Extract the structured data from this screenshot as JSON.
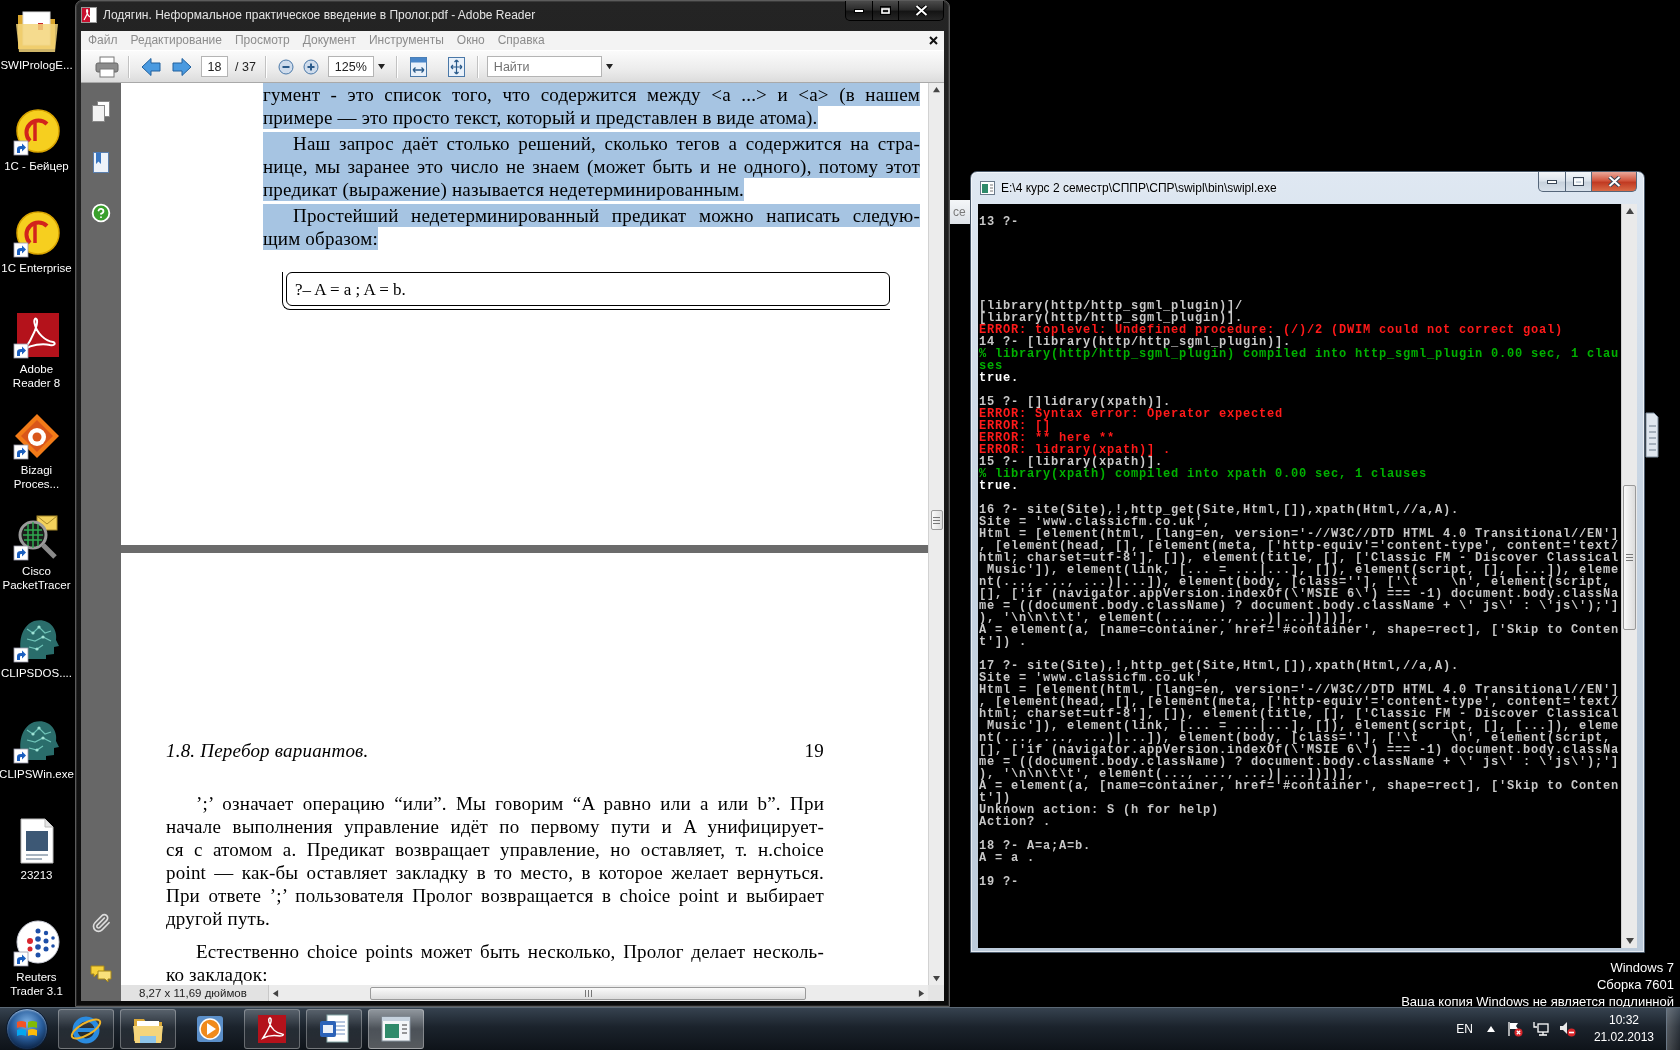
{
  "desktop": {
    "icons": [
      {
        "kind": "folder",
        "shortcut": false,
        "label": [
          "SWIPrologE..."
        ]
      },
      {
        "kind": "disc",
        "shortcut": true,
        "label": [
          "1C - Бейцер"
        ]
      },
      {
        "kind": "disc",
        "shortcut": true,
        "label": [
          "1C Enterprise"
        ]
      },
      {
        "kind": "pdf",
        "shortcut": true,
        "label": [
          "Adobe",
          "Reader 8"
        ]
      },
      {
        "kind": "diamond",
        "shortcut": true,
        "label": [
          "Bizagi",
          "Proces..."
        ]
      },
      {
        "kind": "magnifier",
        "shortcut": true,
        "label": [
          "Cisco",
          "PacketTracer"
        ]
      },
      {
        "kind": "head",
        "shortcut": true,
        "label": [
          "CLIPSDOS...."
        ]
      },
      {
        "kind": "head",
        "shortcut": true,
        "label": [
          "CLIPSWin.exe"
        ]
      },
      {
        "kind": "document",
        "shortcut": false,
        "label": [
          "23213"
        ]
      },
      {
        "kind": "dots",
        "shortcut": true,
        "label": [
          "Reuters",
          "Trader 3.1"
        ]
      }
    ],
    "notice": [
      "Windows 7",
      "Сборка 7601",
      "Ваша копия Windows не является подлинной"
    ]
  },
  "background_window": {
    "title": "ce"
  },
  "reader": {
    "title": "Лодягин. Неформальное практическое введение в Пролог.pdf - Adobe Reader",
    "active": false,
    "menu": [
      "Файл",
      "Редактирование",
      "Просмотр",
      "Документ",
      "Инструменты",
      "Окно",
      "Справка"
    ],
    "toolbar": {
      "page": "18",
      "page_count": "/ 37",
      "zoom": "125%",
      "find_placeholder": "Найти"
    },
    "pages": [
      {
        "blocks": [
          {
            "kind": "paragraph",
            "indented": false,
            "highlighted": true,
            "lines": [
              "гумент - это список того, что содержится между <a ...> и <a> (в нашем",
              "примере — это просто текст, который и представлен в виде атома)."
            ]
          },
          {
            "kind": "paragraph",
            "indented": true,
            "highlighted": true,
            "lines": [
              "Наш запрос даёт столько решений, сколько тегов a содержится на стра-",
              "нице, мы заранее это число не знаем (может быть и не одного), потому этот",
              "предикат (выражение) называется недетерминированным."
            ]
          },
          {
            "kind": "paragraph",
            "indented": true,
            "highlighted": true,
            "lines": [
              "Простейший недетерминированный предикат можно написать следую-",
              "щим образом:"
            ]
          },
          {
            "kind": "code",
            "text": "?– A = a ; A = b."
          }
        ]
      },
      {
        "running_header": {
          "title": "1.8. Перебор вариантов.",
          "number": "19"
        },
        "blocks": [
          {
            "kind": "paragraph",
            "indented": true,
            "highlighted": false,
            "lines": [
              "’;’ означает операцию “или”. Мы говорим “A равно или a или b”. При",
              "начале выполнения управление идёт по первому пути и A унифицирует-",
              "ся с атомом a. Предикат возвращает управление, но оставляет, т. н.choice",
              "point — как-бы оставляет закладку в то место, в которое желает вернуться.",
              "При ответе ’;’ пользователя Пролог возвращается в choice point и выбирает",
              "другой путь."
            ]
          },
          {
            "kind": "paragraph",
            "indented": true,
            "highlighted": false,
            "lines": [
              "Естественно choice points может быть несколько, Пролог делает несколь-",
              "ко закладок:"
            ]
          }
        ]
      }
    ],
    "status": "8,27 x 11,69 дюймов"
  },
  "console": {
    "title": "E:\\4 курс 2 семестр\\СППР\\СПР\\swipl\\bin\\swipl.exe",
    "active": true,
    "lines": [
      {
        "kind": "text",
        "text": "13 ?-"
      },
      {
        "kind": "blank"
      },
      {
        "kind": "blank"
      },
      {
        "kind": "blank"
      },
      {
        "kind": "blank"
      },
      {
        "kind": "blank"
      },
      {
        "kind": "blank"
      },
      {
        "kind": "text",
        "text": "[library(http/http_sgml_plugin)]/"
      },
      {
        "kind": "text",
        "text": "[library(http/http_sgml_plugin)]."
      },
      {
        "kind": "error",
        "text": "ERROR: toplevel: Undefined procedure: (/)/2 (DWIM could not correct goal)"
      },
      {
        "kind": "text",
        "text": "14 ?- [library(http/http_sgml_plugin)]."
      },
      {
        "kind": "info",
        "text": "% library(http/http_sgml_plugin) compiled into http_sgml_plugin 0.00 sec, 1 clau"
      },
      {
        "kind": "info",
        "text": "ses"
      },
      {
        "kind": "result",
        "text": "true."
      },
      {
        "kind": "blank"
      },
      {
        "kind": "text",
        "text": "15 ?- []lidrary(xpath)]."
      },
      {
        "kind": "error",
        "text": "ERROR: Syntax error: Operator expected"
      },
      {
        "kind": "error",
        "text": "ERROR: []"
      },
      {
        "kind": "error",
        "text": "ERROR: ** here **"
      },
      {
        "kind": "error",
        "text": "ERROR: lidrary(xpath)] ."
      },
      {
        "kind": "text",
        "text": "15 ?- [library(xpath)]."
      },
      {
        "kind": "info",
        "text": "% library(xpath) compiled into xpath 0.00 sec, 1 clauses"
      },
      {
        "kind": "result",
        "text": "true."
      },
      {
        "kind": "blank"
      },
      {
        "kind": "text",
        "text": "16 ?- site(Site),!,http_get(Site,Html,[]),xpath(Html,//a,A)."
      },
      {
        "kind": "text",
        "text": "Site = 'www.classicfm.co.uk',"
      },
      {
        "kind": "text",
        "text": "Html = [element(html, [lang=en, version='-//W3C//DTD HTML 4.0 Transitional//EN']"
      },
      {
        "kind": "text",
        "text": ", [element(head, [], [element(meta, ['http-equiv'='content-type', content='text/"
      },
      {
        "kind": "text",
        "text": "html; charset=utf-8'], []), element(title, [], ['Classic FM - Discover Classical"
      },
      {
        "kind": "text",
        "text": " Music']), element(link, [... = ...|...], []), element(script, [], [...]), eleme"
      },
      {
        "kind": "text",
        "text": "nt(..., ..., ...)|...]), element(body, [class=''], ['\\t    \\n', element(script,"
      },
      {
        "kind": "text",
        "text": "[], ['if (navigator.appVersion.indexOf(\\'MSIE 6\\') === -1) document.body.classNa"
      },
      {
        "kind": "text",
        "text": "me = ((document.body.className) ? document.body.className + \\' js\\' : \\'js\\');']"
      },
      {
        "kind": "text",
        "text": "), '\\n\\n\\t\\t', element(..., ..., ...)|...])])],"
      },
      {
        "kind": "text",
        "text": "A = element(a, [name=container, href='#container', shape=rect], ['Skip to Conten"
      },
      {
        "kind": "text",
        "text": "t']) ."
      },
      {
        "kind": "blank"
      },
      {
        "kind": "text",
        "text": "17 ?- site(Site),!,http_get(Site,Html,[]),xpath(Html,//a,A)."
      },
      {
        "kind": "text",
        "text": "Site = 'www.classicfm.co.uk',"
      },
      {
        "kind": "text",
        "text": "Html = [element(html, [lang=en, version='-//W3C//DTD HTML 4.0 Transitional//EN']"
      },
      {
        "kind": "text",
        "text": ", [element(head, [], [element(meta, ['http-equiv'='content-type', content='text/"
      },
      {
        "kind": "text",
        "text": "html; charset=utf-8'], []), element(title, [], ['Classic FM - Discover Classical"
      },
      {
        "kind": "text",
        "text": " Music']), element(link, [... = ...|...], []), element(script, [], [...]), eleme"
      },
      {
        "kind": "text",
        "text": "nt(..., ..., ...)|...]), element(body, [class=''], ['\\t    \\n', element(script,"
      },
      {
        "kind": "text",
        "text": "[], ['if (navigator.appVersion.indexOf(\\'MSIE 6\\') === -1) document.body.classNa"
      },
      {
        "kind": "text",
        "text": "me = ((document.body.className) ? document.body.className + \\' js\\' : \\'js\\');']"
      },
      {
        "kind": "text",
        "text": "), '\\n\\n\\t\\t', element(..., ..., ...)|...])])],"
      },
      {
        "kind": "text",
        "text": "A = element(a, [name=container, href='#container', shape=rect], ['Skip to Conten"
      },
      {
        "kind": "text",
        "text": "t'])"
      },
      {
        "kind": "text",
        "text": "Unknown action: S (h for help)"
      },
      {
        "kind": "text",
        "text": "Action? ."
      },
      {
        "kind": "blank"
      },
      {
        "kind": "text",
        "text": "18 ?- A=a;A=b."
      },
      {
        "kind": "text",
        "text": "A = a ."
      },
      {
        "kind": "blank"
      },
      {
        "kind": "text",
        "text": "19 ?-"
      }
    ]
  },
  "taskbar": {
    "apps": [
      {
        "kind": "browser",
        "running": true,
        "active": false
      },
      {
        "kind": "folder",
        "running": true,
        "active": false
      },
      {
        "kind": "player",
        "running": false,
        "active": false
      },
      {
        "kind": "pdf",
        "running": true,
        "active": false
      },
      {
        "kind": "word",
        "running": true,
        "active": false
      },
      {
        "kind": "console",
        "running": true,
        "active": true
      }
    ],
    "language": "EN",
    "time": "10:32",
    "date": "21.02.2013"
  }
}
